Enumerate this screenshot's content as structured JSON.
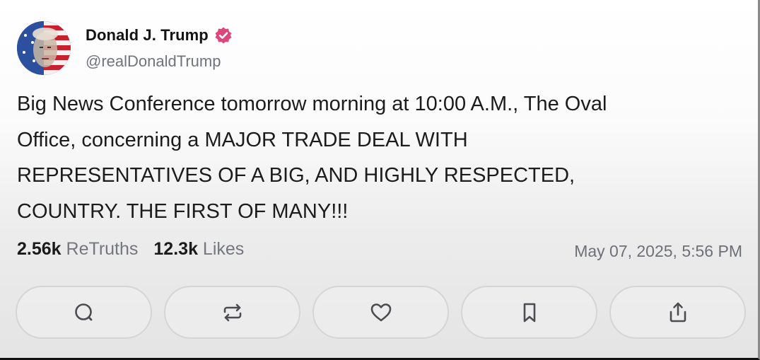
{
  "post": {
    "author_name": "Donald J. Trump",
    "author_handle": "@realDonaldTrump",
    "verified_icon": "verified-badge-icon",
    "verified_color": "#e0457b",
    "body_lines": [
      "Big News Conference tomorrow morning at 10:00 A.M., The Oval",
      "Office, concerning a MAJOR TRADE DEAL WITH",
      "REPRESENTATIVES OF A BIG, AND HIGHLY RESPECTED,",
      "COUNTRY. THE FIRST OF MANY!!!"
    ],
    "retruths_count": "2.56k",
    "retruths_label": "ReTruths",
    "likes_count": "12.3k",
    "likes_label": "Likes",
    "timestamp": "May 07, 2025, 5:56 PM"
  },
  "actions": [
    {
      "icon": "reply-icon"
    },
    {
      "icon": "retruth-icon"
    },
    {
      "icon": "like-heart-icon"
    },
    {
      "icon": "bookmark-icon"
    },
    {
      "icon": "share-icon"
    }
  ]
}
